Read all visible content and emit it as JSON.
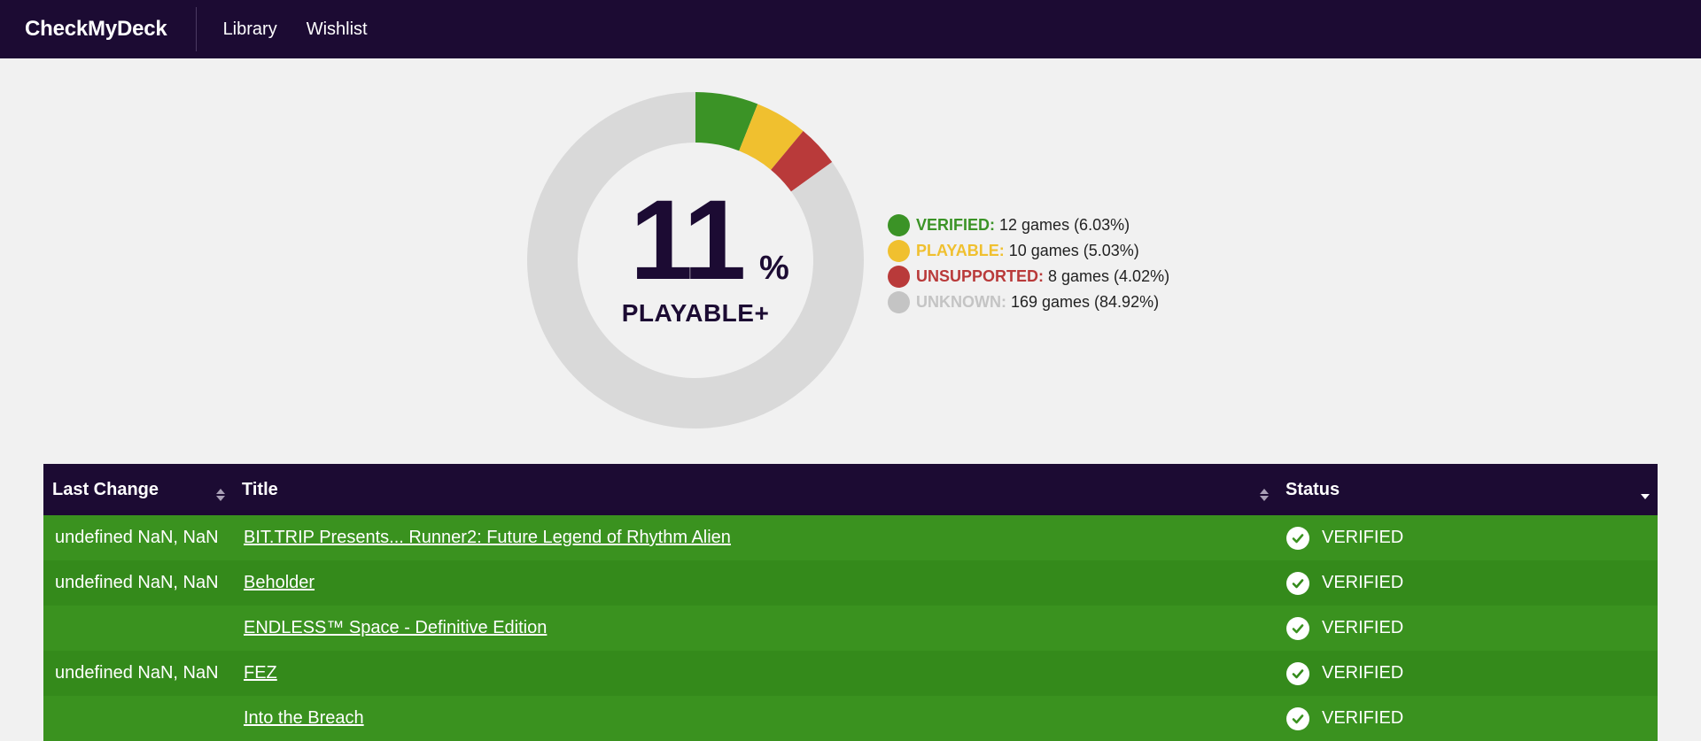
{
  "nav": {
    "brand": "CheckMyDeck",
    "links": [
      "Library",
      "Wishlist"
    ]
  },
  "summary": {
    "percent": "11",
    "percent_sign": "%",
    "label": "PLAYABLE+"
  },
  "chart_data": {
    "type": "pie",
    "categories": [
      "VERIFIED",
      "PLAYABLE",
      "UNSUPPORTED",
      "UNKNOWN"
    ],
    "values": [
      12,
      10,
      8,
      169
    ],
    "colors": [
      "#3b9326",
      "#f0c02f",
      "#b93a3a",
      "#d9d9d9"
    ]
  },
  "legend": [
    {
      "label": "VERIFIED:",
      "text": "12 games (6.03%)",
      "color": "#3b9326"
    },
    {
      "label": "PLAYABLE:",
      "text": "10 games (5.03%)",
      "color": "#f0c02f"
    },
    {
      "label": "UNSUPPORTED:",
      "text": "8 games (4.02%)",
      "color": "#b93a3a"
    },
    {
      "label": "UNKNOWN:",
      "text": "169 games (84.92%)",
      "color": "#c4c4c4"
    }
  ],
  "table": {
    "headers": [
      "Last Change",
      "Title",
      "Status"
    ],
    "rows": [
      {
        "date": "undefined NaN, NaN",
        "title": "BIT.TRIP Presents... Runner2: Future Legend of Rhythm Alien",
        "status": "VERIFIED"
      },
      {
        "date": "undefined NaN, NaN",
        "title": "Beholder",
        "status": "VERIFIED"
      },
      {
        "date": "",
        "title": "ENDLESS™ Space - Definitive Edition",
        "status": "VERIFIED"
      },
      {
        "date": "undefined NaN, NaN",
        "title": "FEZ",
        "status": "VERIFIED"
      },
      {
        "date": "",
        "title": "Into the Breach",
        "status": "VERIFIED"
      }
    ]
  }
}
